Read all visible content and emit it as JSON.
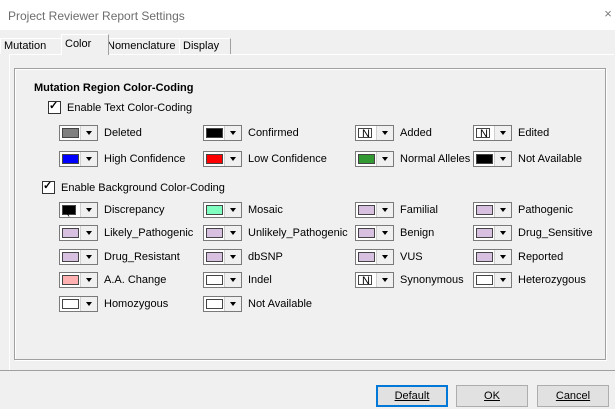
{
  "window": {
    "title": "Project Reviewer Report Settings",
    "close_glyph": "×"
  },
  "tabs": [
    {
      "label": "Mutation"
    },
    {
      "label": "Color"
    },
    {
      "label": "Nomenclature"
    },
    {
      "label": "Display"
    }
  ],
  "active_tab": "Color",
  "section_title": "Mutation Region Color-Coding",
  "text_coding": {
    "checkbox_label": "Enable Text Color-Coding",
    "checked": true,
    "items": [
      {
        "label": "Deleted",
        "color": "#808080",
        "glyph": ""
      },
      {
        "label": "Confirmed",
        "color": "#000000",
        "glyph": ""
      },
      {
        "label": "Added",
        "color": "#ffffff",
        "glyph": "N"
      },
      {
        "label": "Edited",
        "color": "#ffffff",
        "glyph": "N"
      },
      {
        "label": "High Confidence",
        "color": "#0000ff",
        "glyph": ""
      },
      {
        "label": "Low Confidence",
        "color": "#ff0000",
        "glyph": ""
      },
      {
        "label": "Normal Alleles",
        "color": "#339933",
        "glyph": ""
      },
      {
        "label": "Not Available",
        "color": "#000000",
        "glyph": ""
      }
    ]
  },
  "background_coding": {
    "checkbox_label": "Enable Background Color-Coding",
    "checked": true,
    "items": [
      {
        "label": "Discrepancy",
        "color": "#000000",
        "glyph": "("
      },
      {
        "label": "Mosaic",
        "color": "#80ffc0",
        "glyph": ""
      },
      {
        "label": "Familial",
        "color": "#d8c0e0",
        "glyph": ""
      },
      {
        "label": "Pathogenic",
        "color": "#d8c0e0",
        "glyph": ""
      },
      {
        "label": "Likely_Pathogenic",
        "color": "#d8c0e0",
        "glyph": ""
      },
      {
        "label": "Unlikely_Pathogenic",
        "color": "#d8c0e0",
        "glyph": ""
      },
      {
        "label": "Benign",
        "color": "#d8c0e0",
        "glyph": ""
      },
      {
        "label": "Drug_Sensitive",
        "color": "#d8c0e0",
        "glyph": ""
      },
      {
        "label": "Drug_Resistant",
        "color": "#d8c0e0",
        "glyph": ""
      },
      {
        "label": "dbSNP",
        "color": "#d8c0e0",
        "glyph": ""
      },
      {
        "label": "VUS",
        "color": "#d8c0e0",
        "glyph": ""
      },
      {
        "label": "Reported",
        "color": "#d8c0e0",
        "glyph": ""
      },
      {
        "label": "A.A. Change",
        "color": "#ffb0b0",
        "glyph": ""
      },
      {
        "label": "Indel",
        "color": "#ffffff",
        "glyph": ""
      },
      {
        "label": "Synonymous",
        "color": "#ffffff",
        "glyph": "N"
      },
      {
        "label": "Heterozygous",
        "color": "#ffffff",
        "glyph": ""
      },
      {
        "label": "Homozygous",
        "color": "#ffffff",
        "glyph": ""
      },
      {
        "label": "Not Available",
        "color": "#ffffff",
        "glyph": ""
      }
    ]
  },
  "buttons": {
    "default": "Default",
    "ok": "OK",
    "cancel": "Cancel"
  }
}
